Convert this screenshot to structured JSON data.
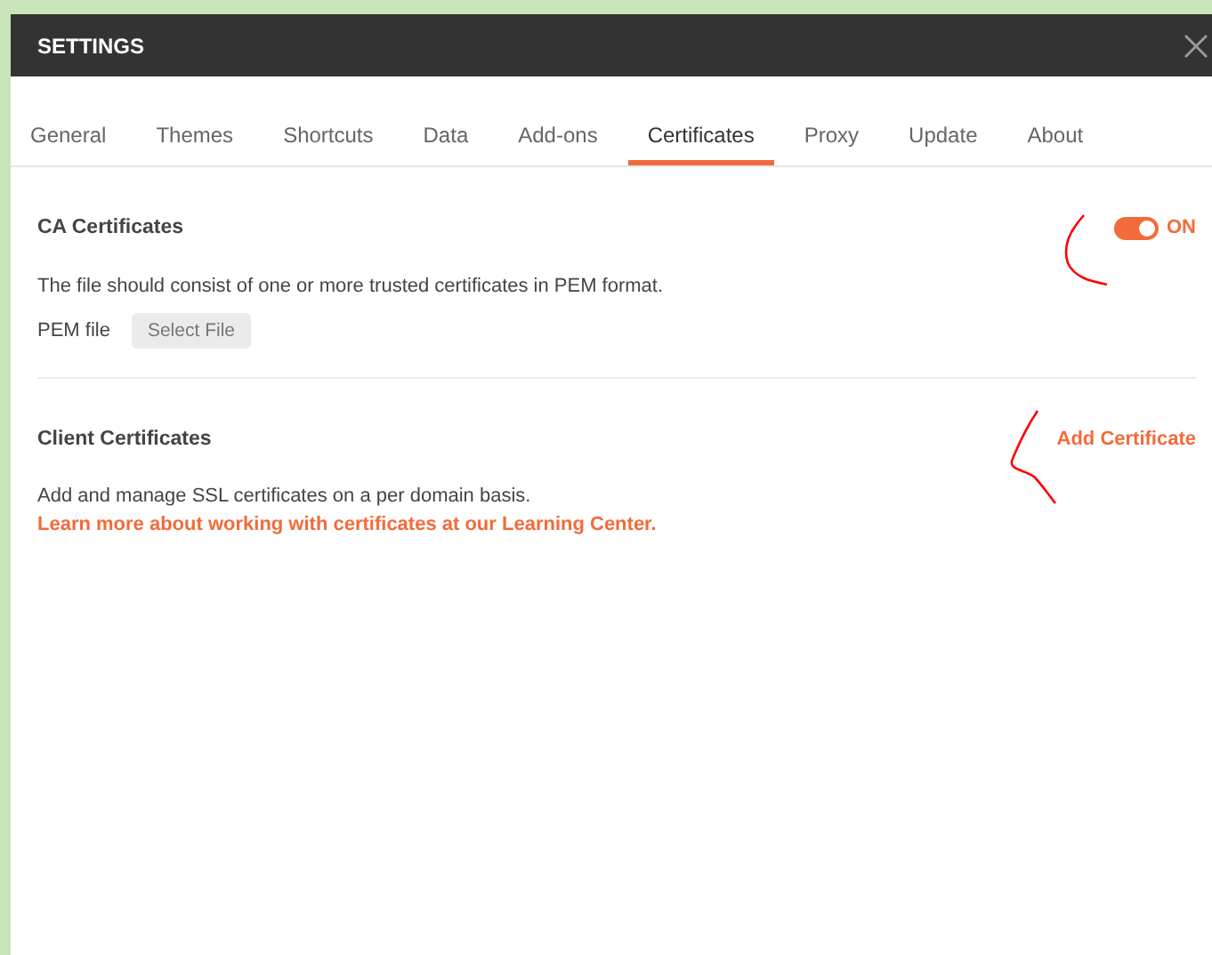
{
  "window": {
    "title": "SETTINGS"
  },
  "tabs": [
    {
      "label": "General",
      "selected": false
    },
    {
      "label": "Themes",
      "selected": false
    },
    {
      "label": "Shortcuts",
      "selected": false
    },
    {
      "label": "Data",
      "selected": false
    },
    {
      "label": "Add-ons",
      "selected": false
    },
    {
      "label": "Certificates",
      "selected": true
    },
    {
      "label": "Proxy",
      "selected": false
    },
    {
      "label": "Update",
      "selected": false
    },
    {
      "label": "About",
      "selected": false
    }
  ],
  "ca_certificates": {
    "title": "CA Certificates",
    "toggle": {
      "on": true,
      "label": "ON"
    },
    "description": "The file should consist of one or more trusted certificates in PEM format.",
    "pem_label": "PEM file",
    "select_button": "Select File"
  },
  "client_certificates": {
    "title": "Client Certificates",
    "action": "Add Certificate",
    "description": "Add and manage SSL certificates on a per domain basis.",
    "link": "Learn more about working with certificates at our Learning Center."
  }
}
